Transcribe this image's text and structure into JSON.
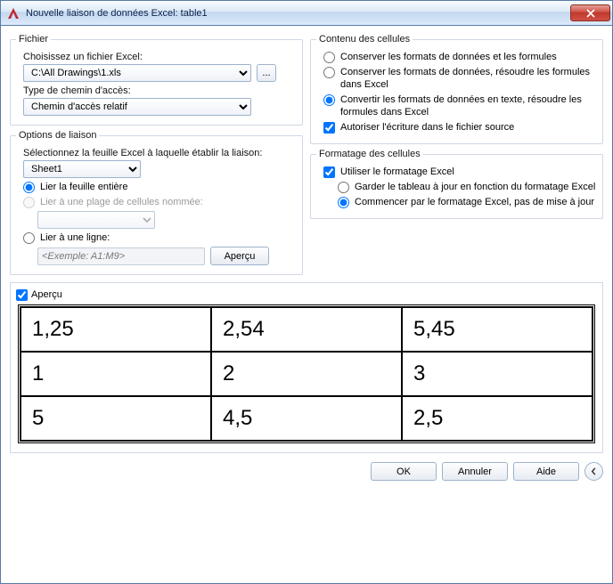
{
  "window": {
    "title": "Nouvelle liaison de données Excel: table1"
  },
  "file": {
    "legend": "Fichier",
    "choose_label": "Choisissez un fichier Excel:",
    "path_value": "C:\\All Drawings\\1.xls",
    "path_type_label": "Type de chemin d'accès:",
    "path_type_value": "Chemin d'accès relatif"
  },
  "link_options": {
    "legend": "Options de liaison",
    "select_sheet_label": "Sélectionnez la feuille Excel à laquelle établir la liaison:",
    "sheet_value": "Sheet1",
    "link_entire": "Lier la feuille entière",
    "link_named": "Lier à une plage de cellules nommée:",
    "link_row": "Lier à une ligne:",
    "row_placeholder": "<Exemple: A1:M9>",
    "preview_btn": "Aperçu"
  },
  "cell_content": {
    "legend": "Contenu des cellules",
    "opt_keep": "Conserver les formats de données et les formules",
    "opt_keep_resolve": "Conserver les formats de données, résoudre les formules dans Excel",
    "opt_convert": "Convertir les formats de données en texte, résoudre les formules dans Excel",
    "allow_write": "Autoriser l'écriture dans le fichier source"
  },
  "cell_format": {
    "legend": "Formatage des cellules",
    "use_excel_format": "Utiliser le formatage Excel",
    "keep_updated": "Garder le tableau à jour en fonction du formatage Excel",
    "start_excel_no_update": "Commencer par le formatage Excel, pas de mise à jour"
  },
  "preview": {
    "label": "Aperçu",
    "rows": [
      [
        "1,25",
        "2,54",
        "5,45"
      ],
      [
        "1",
        "2",
        "3"
      ],
      [
        "5",
        "4,5",
        "2,5"
      ]
    ]
  },
  "footer": {
    "ok": "OK",
    "cancel": "Annuler",
    "help": "Aide"
  }
}
